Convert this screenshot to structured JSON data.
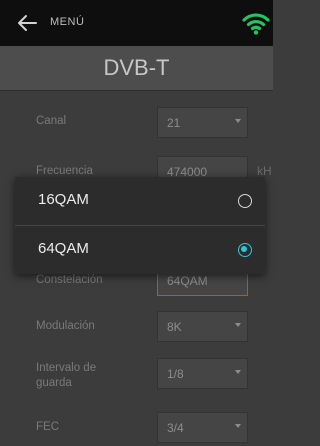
{
  "topbar": {
    "back_icon": "arrow-left-icon",
    "menu_label": "MENÚ",
    "wifi_icon": "wifi-icon",
    "wifi_color": "#22c55e"
  },
  "title": "DVB-T",
  "form": {
    "canal": {
      "label": "Canal",
      "value": "21"
    },
    "frecuencia": {
      "label": "Frecuencia",
      "value": "474000",
      "unit": "kH"
    },
    "constelacion": {
      "label": "Constelación",
      "value": "64QAM",
      "unit": ""
    },
    "modulacion": {
      "label": "Modulación",
      "value": "8K"
    },
    "intervalo": {
      "label": "Intervalo de guarda",
      "value": "1/8"
    },
    "fec": {
      "label": "FEC",
      "value": "3/4"
    }
  },
  "dialog": {
    "options": [
      {
        "label": "16QAM",
        "selected": false
      },
      {
        "label": "64QAM",
        "selected": true
      }
    ],
    "accent": "#31c5d2"
  }
}
